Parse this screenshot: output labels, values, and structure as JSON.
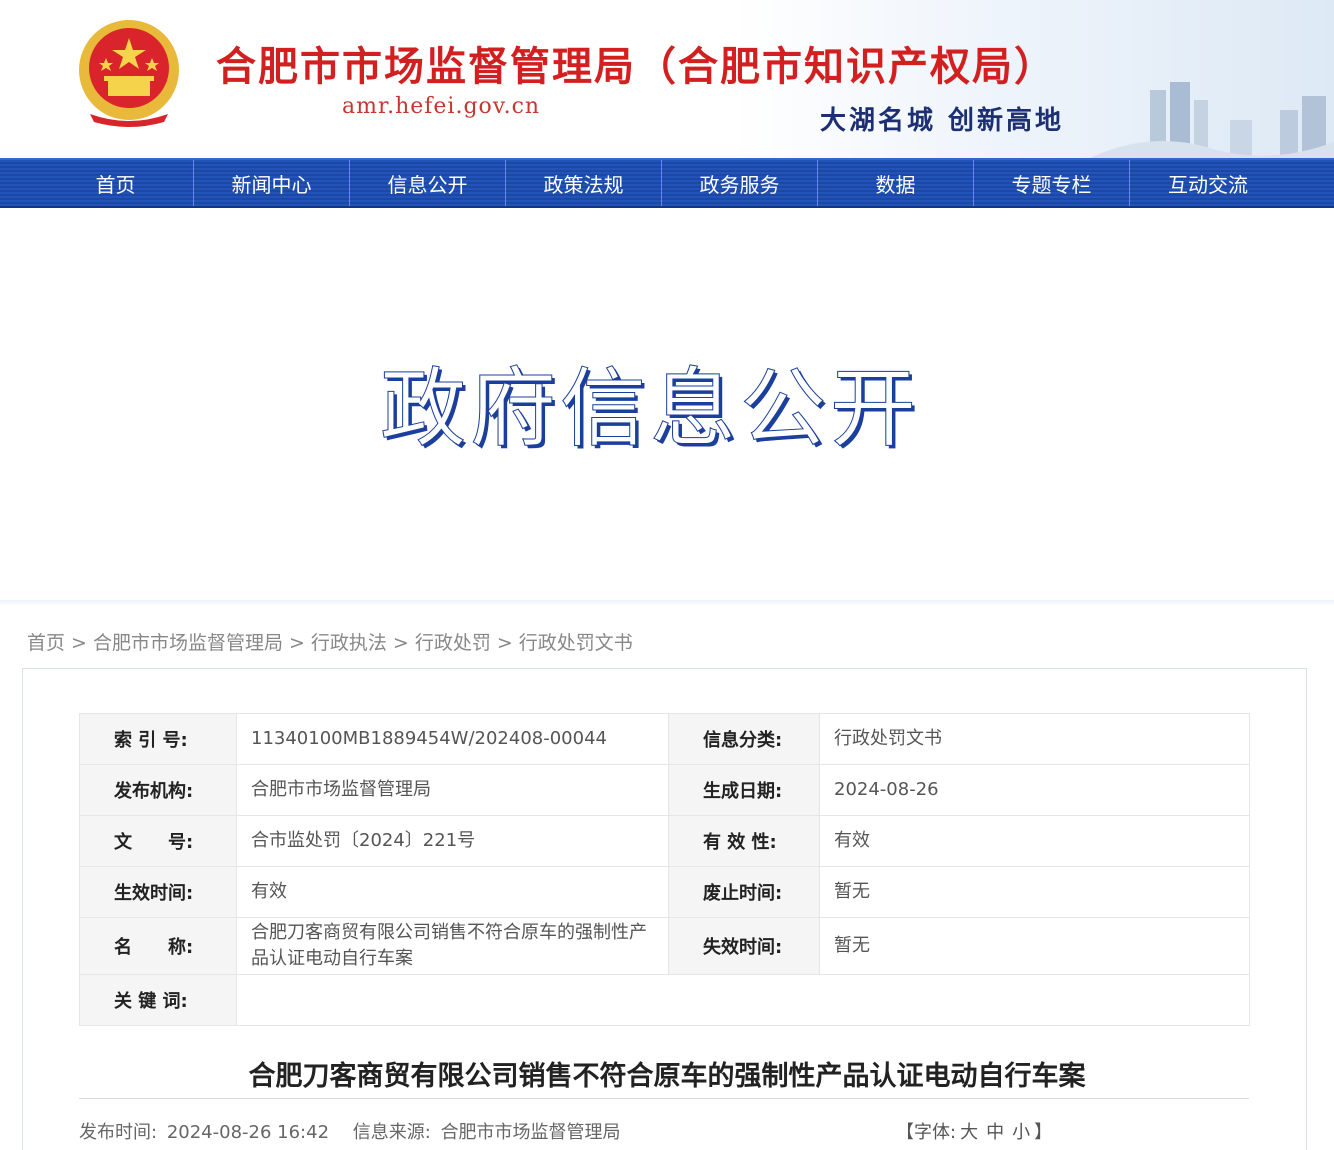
{
  "header": {
    "site_title": "合肥市市场监督管理局（合肥市知识产权局）",
    "site_url": "amr.hefei.gov.cn",
    "slogan": "大湖名城  创新高地",
    "emblem_icon": "national-emblem-icon"
  },
  "nav": {
    "items": [
      {
        "label": "首页"
      },
      {
        "label": "新闻中心"
      },
      {
        "label": "信息公开"
      },
      {
        "label": "政策法规"
      },
      {
        "label": "政务服务"
      },
      {
        "label": "数据"
      },
      {
        "label": "专题专栏"
      },
      {
        "label": "互动交流"
      }
    ]
  },
  "banner": {
    "title": "政府信息公开"
  },
  "breadcrumb": {
    "items": [
      {
        "label": "首页"
      },
      {
        "label": "合肥市市场监督管理局"
      },
      {
        "label": "行政执法"
      },
      {
        "label": "行政处罚"
      },
      {
        "label": "行政处罚文书"
      }
    ],
    "separator": ">"
  },
  "meta": {
    "index_no_label": "索 引 号:",
    "index_no": "11340100MB1889454W/202408-00044",
    "category_label": "信息分类:",
    "category": "行政处罚文书",
    "publisher_label": "发布机构:",
    "publisher": "合肥市市场监督管理局",
    "gen_date_label": "生成日期:",
    "gen_date": "2024-08-26",
    "doc_no_label": "文　　号:",
    "doc_no": "合市监处罚〔2024〕221号",
    "validity_label": "有 效 性:",
    "validity": "有效",
    "effective_label": "生效时间:",
    "effective": "有效",
    "repeal_label": "废止时间:",
    "repeal": "暂无",
    "name_label": "名　　称:",
    "name": "合肥刀客商贸有限公司销售不符合原车的强制性产品认证电动自行车案",
    "expire_label": "失效时间:",
    "expire": "暂无",
    "keywords_label": "关 键 词:",
    "keywords": ""
  },
  "article": {
    "title": "合肥刀客商贸有限公司销售不符合原车的强制性产品认证电动自行车案",
    "pub_time_label": "发布时间:",
    "pub_time": "2024-08-26 16:42",
    "source_label": "信息来源:",
    "source": "合肥市市场监督管理局",
    "font_label_open": "【字体:",
    "font_large": "大",
    "font_medium": "中",
    "font_small": "小",
    "font_label_close": "】"
  },
  "colors": {
    "title_red": "#d21f1f",
    "nav_blue": "#1c47a4",
    "slogan_navy": "#1c2f73"
  }
}
